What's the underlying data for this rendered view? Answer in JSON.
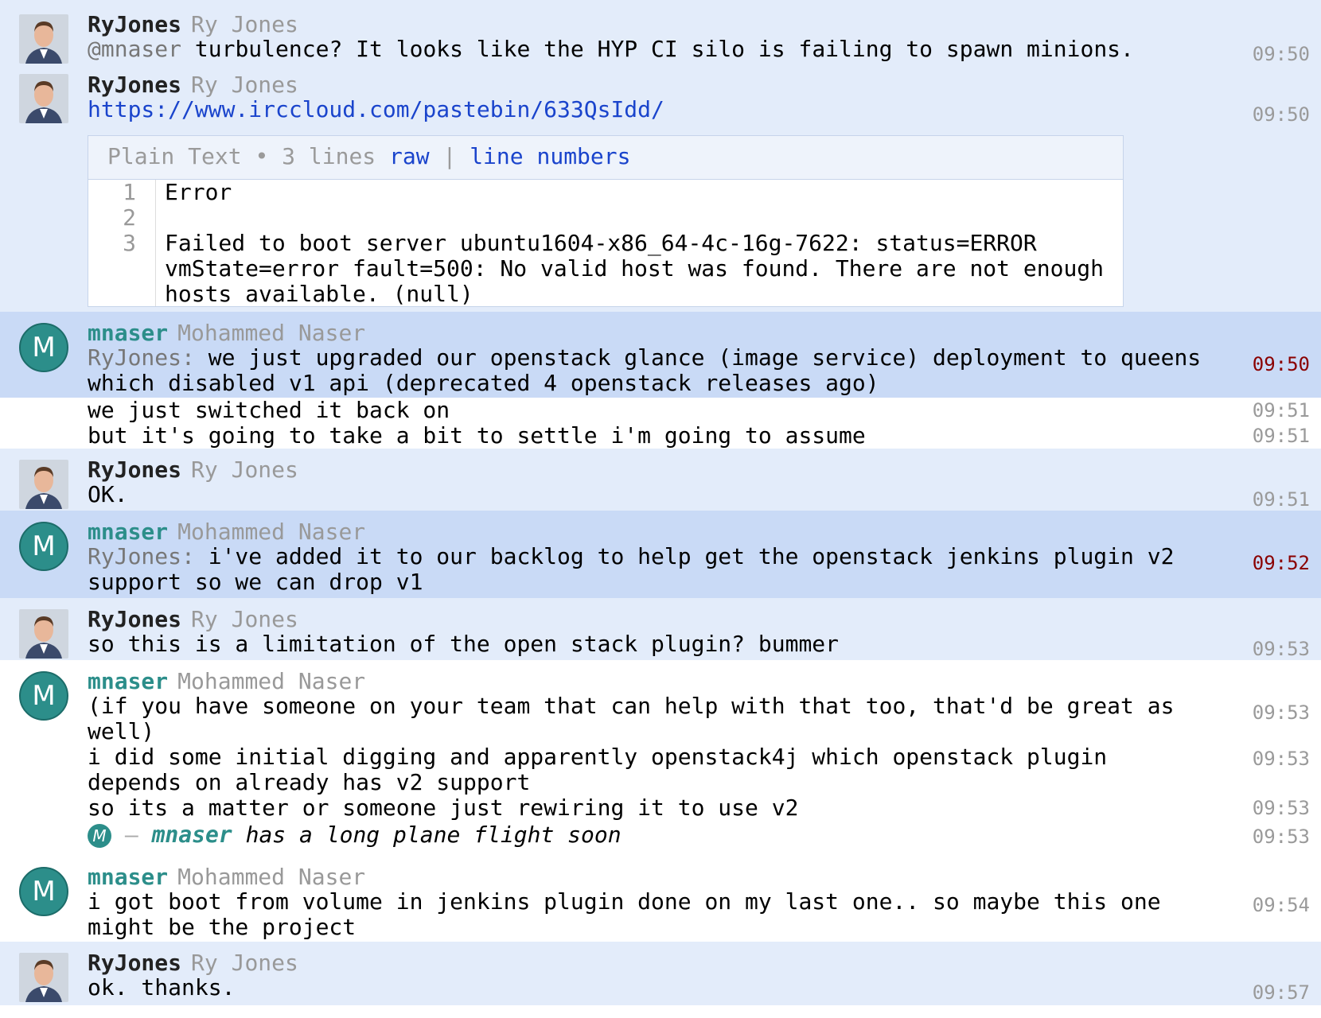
{
  "users": {
    "ry": {
      "nick": "RyJones",
      "real": "Ry Jones"
    },
    "mn": {
      "nick": "mnaser",
      "real": "Mohammed Naser",
      "initial": "M"
    }
  },
  "messages": {
    "m1": {
      "mention": "@mnaser",
      "text": " turbulence? It looks like the HYP CI silo is failing to spawn minions.",
      "time": "09:50"
    },
    "m2": {
      "link": "https://www.irccloud.com/pastebin/633QsIdd/",
      "time": "09:50"
    },
    "paste": {
      "type": "Plain Text",
      "sep": "•",
      "count": "3 lines",
      "raw": "raw",
      "pipe": "|",
      "line_numbers": "line numbers",
      "numbers": [
        "1",
        "2",
        "3"
      ],
      "lines": [
        "Error",
        "",
        "Failed to boot server ubuntu1604-x86_64-4c-16g-7622: status=ERROR vmState=error fault=500: No valid host was found. There are not enough hosts available. (null)"
      ]
    },
    "m3": {
      "mention": "RyJones:",
      "text": " we just upgraded our openstack glance (image service) deployment to queens which disabled v1 api (deprecated 4 openstack releases ago)",
      "time": "09:50"
    },
    "m4": {
      "text": "we just switched it back on",
      "time": "09:51"
    },
    "m5": {
      "text": "but it's going to take a bit to settle i'm going to assume",
      "time": "09:51"
    },
    "m6": {
      "text": "OK.",
      "time": "09:51"
    },
    "m7": {
      "mention": "RyJones:",
      "text": " i've added it to our backlog to help get the openstack jenkins plugin v2 support so we can drop v1",
      "time": "09:52"
    },
    "m8": {
      "text": "so this is a limitation of the open stack plugin? bummer",
      "time": "09:53"
    },
    "m9": {
      "text": "(if you have someone on your team that can help with that too, that'd be great as well)",
      "time": "09:53"
    },
    "m10": {
      "text": "i did some initial digging and apparently openstack4j which openstack plugin depends on already has v2 support",
      "time": "09:53"
    },
    "m11": {
      "text": "so its a matter or someone just rewiring it to use v2",
      "time": "09:53"
    },
    "m12": {
      "dash": "—",
      "nick": "mnaser",
      "text": "has a long plane flight soon",
      "time": "09:53"
    },
    "m13": {
      "text": "i got boot from volume in jenkins plugin done on my last one.. so maybe this one might be the project",
      "time": "09:54"
    },
    "m14": {
      "text": "ok. thanks.",
      "time": "09:57"
    }
  },
  "colors": {
    "row_blue": "#e3ecfa",
    "row_highlight": "#c9daf6",
    "nick_teal": "#2c8e8a",
    "link_blue": "#1a44cc",
    "highlight_time": "#8a0000"
  },
  "icons": {
    "avatar_ry": "user-photo-avatar",
    "avatar_mn": "letter-avatar-m"
  }
}
